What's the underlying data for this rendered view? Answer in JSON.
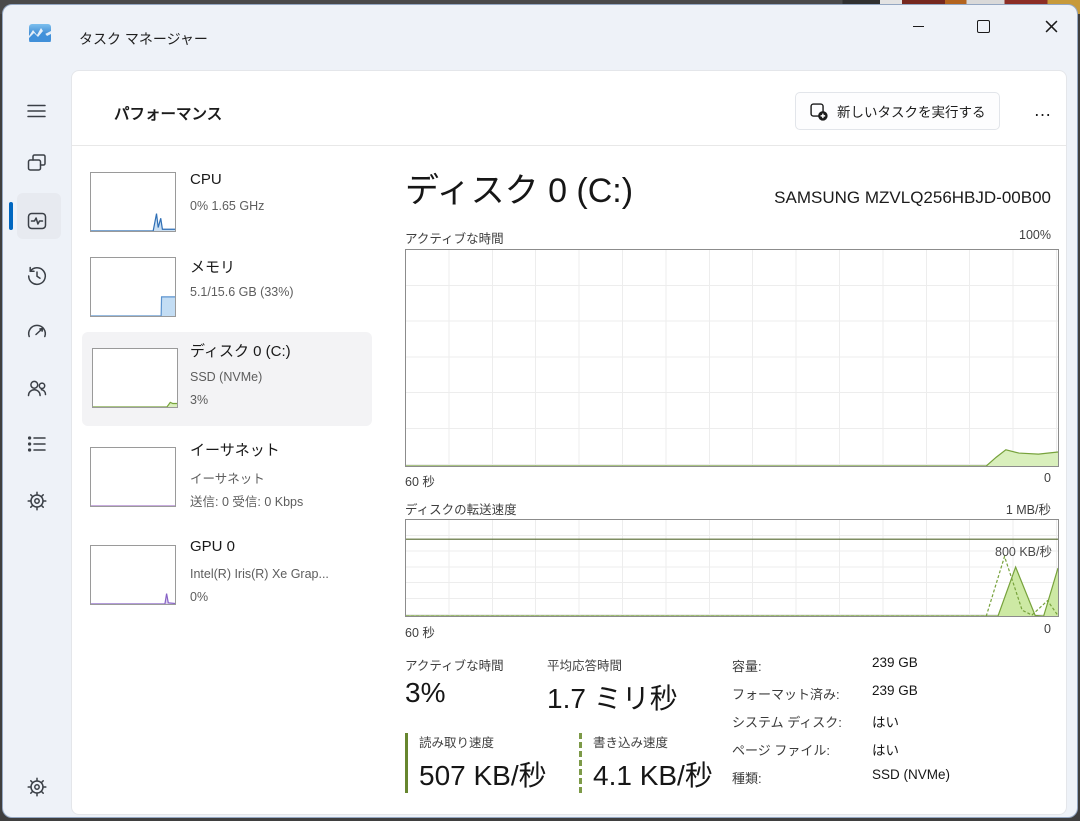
{
  "window": {
    "title": "タスク マネージャー"
  },
  "header": {
    "page_title": "パフォーマンス",
    "run_new_task_label": "新しいタスクを実行する",
    "more_label": "…"
  },
  "icons": {
    "app": "task-manager-wave",
    "hamburger": "three-lines",
    "processes": "window-panes",
    "performance": "pulse-square",
    "app-history": "clock-history",
    "startup-apps": "gauge",
    "users": "people",
    "details": "bulleted-list",
    "services": "gear-outline",
    "settings": "gear",
    "run-new-task": "square-plus",
    "more": "ellipsis",
    "minimize": "line",
    "maximize": "box",
    "close": "x"
  },
  "perf_list": [
    {
      "title": "CPU",
      "line1": "0%  1.65 GHz",
      "line2": ""
    },
    {
      "title": "メモリ",
      "line1": "5.1/15.6 GB (33%)",
      "line2": ""
    },
    {
      "title": "ディスク 0 (C:)",
      "line1": "SSD (NVMe)",
      "line2": "3%",
      "selected": true
    },
    {
      "title": "イーサネット",
      "line1": "イーサネット",
      "line2": "送信: 0 受信: 0 Kbps"
    },
    {
      "title": "GPU 0",
      "line1": "Intel(R) Iris(R) Xe Grap...",
      "line2": "0%"
    }
  ],
  "main": {
    "title": "ディスク 0 (C:)",
    "device": "SAMSUNG MZVLQ256HBJD-00B00",
    "chart1_label": "アクティブな時間",
    "chart1_max": "100%",
    "chart1_x_left": "60 秒",
    "chart1_x_right": "0",
    "chart2_label": "ディスクの転送速度",
    "chart2_max": "1 MB/秒",
    "chart2_marker_label": "800 KB/秒",
    "chart2_x_left": "60 秒",
    "chart2_x_right": "0",
    "stats": {
      "active_time_label": "アクティブな時間",
      "active_time_value": "3%",
      "response_label": "平均応答時間",
      "response_value": "1.7 ミリ秒",
      "read_label": "読み取り速度",
      "read_value": "507 KB/秒",
      "write_label": "書き込み速度",
      "write_value": "4.1 KB/秒"
    },
    "details": [
      {
        "label": "容量:",
        "value": "239 GB"
      },
      {
        "label": "フォーマット済み:",
        "value": "239 GB"
      },
      {
        "label": "システム ディスク:",
        "value": "はい"
      },
      {
        "label": "ページ ファイル:",
        "value": "はい"
      },
      {
        "label": "種類:",
        "value": "SSD (NVMe)"
      }
    ]
  },
  "colors": {
    "accent": "#0067c0",
    "disk_green": "#77a23c",
    "disk_fill": "#d9efbc",
    "marker_green": "#55682e",
    "cpu_blue": "#2f6fb5",
    "mem_blue": "#5b93cf",
    "gpu_purple": "#8661c5"
  },
  "chart_data": [
    {
      "id": "active-time",
      "type": "area",
      "title": "アクティブな時間 (%)",
      "ylim": [
        0,
        100
      ],
      "x_axis": "seconds, 60 → 0",
      "grid": true,
      "series": [
        {
          "name": "アクティブな時間",
          "color": "#77a23c",
          "fill": "#d9efbc",
          "points": [
            [
              0,
              0
            ],
            [
              89,
              0
            ],
            [
              90.5,
              4
            ],
            [
              92,
              7.5
            ],
            [
              94,
              6
            ],
            [
              97,
              5.5
            ],
            [
              100,
              6.5
            ]
          ]
        }
      ]
    },
    {
      "id": "transfer-rate",
      "type": "area",
      "title": "ディスクの転送速度 (KB/秒)",
      "ylim": [
        0,
        1000
      ],
      "x_axis": "seconds, 60 → 0",
      "grid": true,
      "marker": {
        "value": 800,
        "label": "800 KB/秒",
        "color": "#55682e"
      },
      "series": [
        {
          "name": "読み取り速度",
          "color": "#77a23c",
          "fill": "#cde9a4",
          "points": [
            [
              0,
              0
            ],
            [
              89.5,
              0
            ],
            [
              90.8,
              0
            ],
            [
              93.5,
              510
            ],
            [
              96.5,
              5
            ],
            [
              97.8,
              0
            ],
            [
              100,
              500
            ]
          ]
        },
        {
          "name": "書き込み速度",
          "color": "#77a23c",
          "dash": true,
          "points": [
            [
              0,
              0
            ],
            [
              89,
              0
            ],
            [
              91.8,
              620
            ],
            [
              94.5,
              60
            ],
            [
              96,
              10
            ],
            [
              98.4,
              160
            ],
            [
              100,
              4
            ]
          ]
        }
      ]
    }
  ],
  "sparks": [
    {
      "for": "CPU",
      "ylim": [
        0,
        100
      ],
      "series": [
        {
          "name": "cpu",
          "color": "#2f6fb5",
          "fill": "#c9def2",
          "points": [
            [
              0,
              0
            ],
            [
              74,
              0
            ],
            [
              78,
              30
            ],
            [
              80,
              6
            ],
            [
              83,
              22
            ],
            [
              85,
              3
            ],
            [
              100,
              3
            ]
          ]
        }
      ]
    },
    {
      "for": "メモリ",
      "ylim": [
        0,
        100
      ],
      "series": [
        {
          "name": "memory-used",
          "color": "#5b93cf",
          "fill": "#c3ddf4",
          "points": [
            [
              0,
              0
            ],
            [
              83.5,
              0
            ],
            [
              84,
              33
            ],
            [
              100,
              33
            ]
          ]
        }
      ]
    },
    {
      "for": "ディスク 0 (C:)",
      "ylim": [
        0,
        100
      ],
      "series": [
        {
          "name": "disk",
          "color": "#77a23c",
          "fill": "#d9efbc",
          "points": [
            [
              0,
              0
            ],
            [
              88,
              0
            ],
            [
              92,
              8
            ],
            [
              95,
              6
            ],
            [
              100,
              6
            ]
          ]
        }
      ]
    },
    {
      "for": "イーサネット",
      "ylim": [
        0,
        100
      ],
      "series": [
        {
          "name": "ethernet",
          "color": "#a87bc9",
          "points": [
            [
              0,
              0
            ],
            [
              100,
              0
            ]
          ]
        }
      ]
    },
    {
      "for": "GPU 0",
      "ylim": [
        0,
        100
      ],
      "series": [
        {
          "name": "gpu",
          "color": "#8661c5",
          "fill": "#ded2f0",
          "points": [
            [
              0,
              0
            ],
            [
              88,
              0
            ],
            [
              90,
              18
            ],
            [
              92,
              2
            ],
            [
              100,
              1
            ]
          ]
        }
      ]
    }
  ]
}
